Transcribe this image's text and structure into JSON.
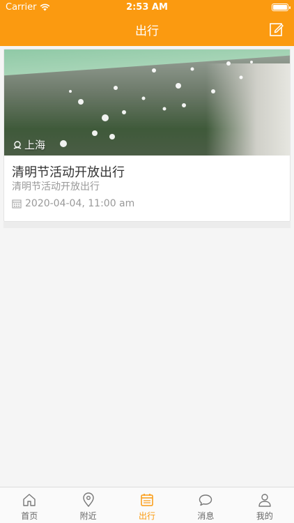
{
  "status_bar": {
    "carrier": "Carrier",
    "time": "2:53 AM"
  },
  "nav": {
    "title": "出行",
    "edit_icon": "edit-icon"
  },
  "colors": {
    "accent": "#fb9a10",
    "background": "#f5f5f5",
    "text_primary": "#333333",
    "text_secondary": "#999999"
  },
  "events": [
    {
      "location": "上海",
      "title": "清明节活动开放出行",
      "subtitle": "清明节活动开放出行",
      "datetime": "2020-04-04, 11:00 am"
    }
  ],
  "tabs": [
    {
      "label": "首页",
      "icon": "home-icon",
      "active": false
    },
    {
      "label": "附近",
      "icon": "location-pin-icon",
      "active": false
    },
    {
      "label": "出行",
      "icon": "calendar-icon",
      "active": true
    },
    {
      "label": "消息",
      "icon": "chat-bubble-icon",
      "active": false
    },
    {
      "label": "我的",
      "icon": "user-icon",
      "active": false
    }
  ]
}
